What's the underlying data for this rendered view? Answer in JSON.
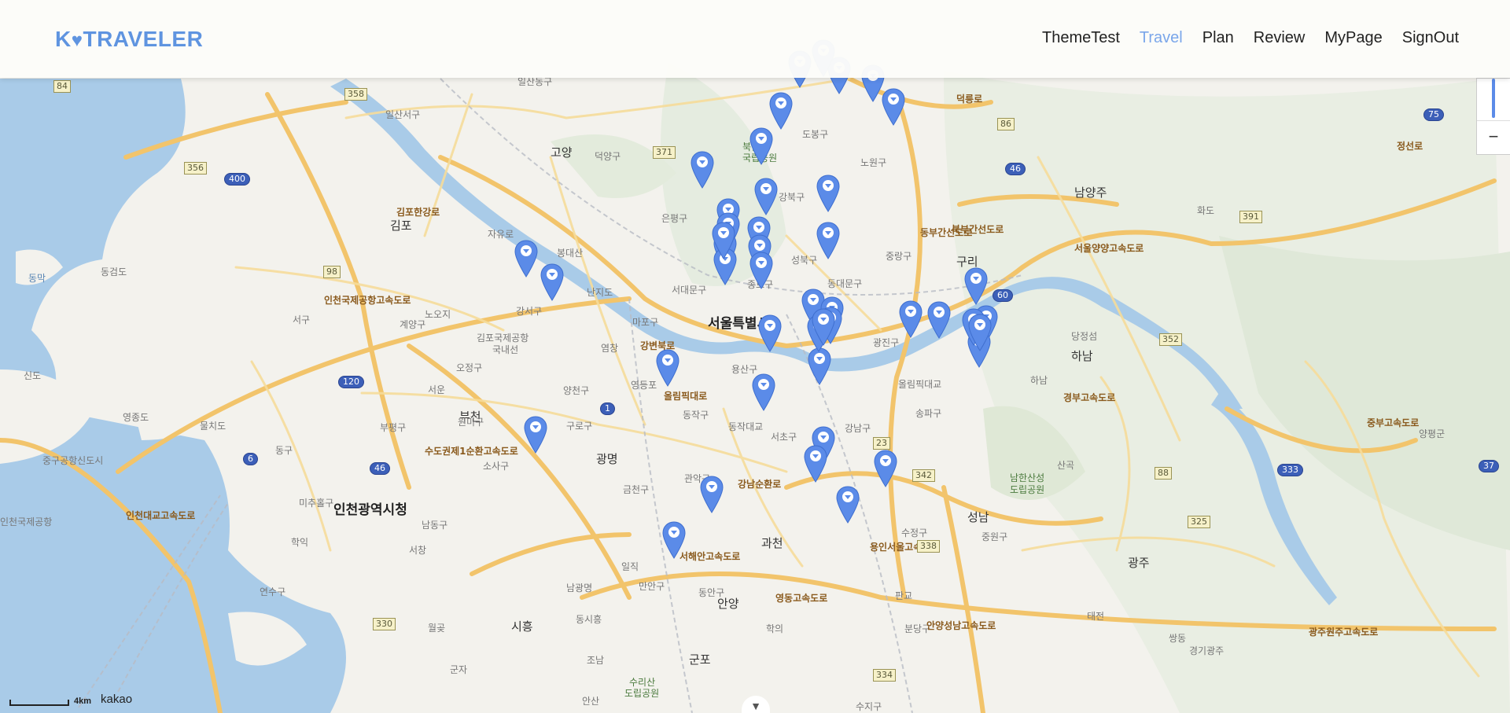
{
  "app": {
    "logo_text": "K TRAVELER",
    "logo_first": "K",
    "logo_rest": "TRAVELER"
  },
  "nav": {
    "items": [
      {
        "label": "ThemeTest",
        "active": false
      },
      {
        "label": "Travel",
        "active": true
      },
      {
        "label": "Plan",
        "active": false
      },
      {
        "label": "Review",
        "active": false
      },
      {
        "label": "MyPage",
        "active": false
      },
      {
        "label": "SignOut",
        "active": false
      }
    ]
  },
  "colors": {
    "accent": "#5f94e0",
    "nav_active": "#7aa6ea",
    "marker": "#5b8be8",
    "water": "#a9cbe8",
    "road": "#f2c46b"
  },
  "map": {
    "zoom_out_label": "−",
    "scale_distance": "4km",
    "provider": "kakao",
    "labels": {
      "seoul": "서울특별시",
      "incheon": "인천광역시청",
      "gimpo": "김포",
      "goyang": "고양",
      "guri": "구리",
      "namyangju": "남양주",
      "hanam": "하남",
      "seongnam": "성남",
      "gwangmyeong": "광명",
      "gwacheon": "과천",
      "anyang": "안양",
      "gunpo": "군포",
      "siheung": "시흥",
      "gwangju": "광주",
      "bucheon": "부천",
      "ilsandong": "일산동구",
      "ilsanseo": "일산서구",
      "deogyang": "덕양구",
      "eunpyeong": "은평구",
      "dobong": "도봉구",
      "nowon": "노원구",
      "gangbuk": "강북구",
      "seongbuk": "성북구",
      "jungnang": "중랑구",
      "dongdaemun": "동대문구",
      "jongno": "종로구",
      "seodaemun": "서대문구",
      "mapo": "마포구",
      "yongsan": "용산구",
      "gwangjin": "광진구",
      "gangseo": "강서구",
      "yangcheon": "양천구",
      "guro": "구로구",
      "yeongdeungpo": "영등포",
      "dongjak": "동작구",
      "seocho": "서초구",
      "gangnam": "강남구",
      "songpa": "송파구",
      "geumcheon": "금천구",
      "gwanak": "관악구",
      "sosa": "소사구",
      "wonmi": "원미구",
      "bupyeong": "부평구",
      "gyeyang": "계양구",
      "seogu": "서구",
      "donggu": "동구",
      "michuhol": "미추홀구",
      "namdong": "남동구",
      "yeonsu": "연수구",
      "ojeong": "오정구",
      "gimpo_airport": "김포국제공항",
      "gimpo_airport2": "국내선",
      "incheon_airport": "인천국제공항",
      "yeongjongdo": "영종도",
      "mulchido": "물치도",
      "sindo": "신도",
      "donggeomdo": "동검도",
      "bukhansan": "북한산",
      "bukhansan2": "국립공원",
      "namhansanseong": "남한산성",
      "namhansanseong2": "도립공원",
      "surisan": "수리산",
      "surisan2": "도립공원",
      "nanjido": "난지도",
      "olympic_bridge": "올림픽대교",
      "dongjak_bridge": "동작대교",
      "sujeong": "수정구",
      "jungwon": "중원구",
      "bundang": "분당구",
      "suji": "수지구",
      "dongan": "동안구",
      "manan": "만안구",
      "yangpyeong": "양평군",
      "dangjeong": "당정섬",
      "hwado": "화도",
      "teojeon": "태전",
      "ssangdong": "쌍동",
      "gyeonggi_gwangju": "경기광주",
      "pangyo": "판교",
      "hakik": "학익",
      "seochang": "서창",
      "yeonsu2": "연수구",
      "wolgot": "월곶",
      "gunja": "군자",
      "ansan": "안산",
      "jogam": "조남",
      "ilik": "일직",
      "namyangyeong": "남광명",
      "dongsi": "동시흥",
      "sanbon": "산곡",
      "hakui": "학의",
      "hanam2": "하남",
      "yeomchang": "염창",
      "noji": "노오지",
      "jayuro": "자유로",
      "bongdaesan": "봉대산",
      "seoun": "서운",
      "gonghang": "중구공항신도시",
      "dongmak": "동막",
      "road_incheon_airport": "인천국제공항고속도로",
      "road_olympic": "올림픽대로",
      "road_gangbyeon": "강변북로",
      "road_seoul_yangyang": "서울양양고속도로",
      "road_bukbu": "북부간선도로",
      "road_seoul_ring": "수도권제1순환고속도로",
      "road_gangnam_sunhwan": "강남순환로",
      "road_seohaean": "서해안고속도로",
      "road_yeongdong": "영동고속도로",
      "road_gwangju_wonju": "광주원주고속도로",
      "road_incheondaegyo": "인천대교고속도로",
      "road_yongin_seoul": "용인서울고속도로",
      "road_anyang_seongnam": "안양성남고속도로",
      "road_donebu": "동부간선도로",
      "road_jungbu": "중부고속도로",
      "road_gimpo": "김포한강로",
      "road_deok": "덕릉로",
      "road_gyeongbu": "경부고속도로",
      "road_jeongseon": "정선로"
    },
    "shields": [
      "84",
      "358",
      "356",
      "400",
      "371",
      "98",
      "120",
      "6",
      "46",
      "86",
      "46",
      "60",
      "352",
      "391",
      "75",
      "23",
      "342",
      "338",
      "88",
      "325",
      "333",
      "37",
      "330",
      "334",
      "1"
    ],
    "marker_count": 44
  }
}
